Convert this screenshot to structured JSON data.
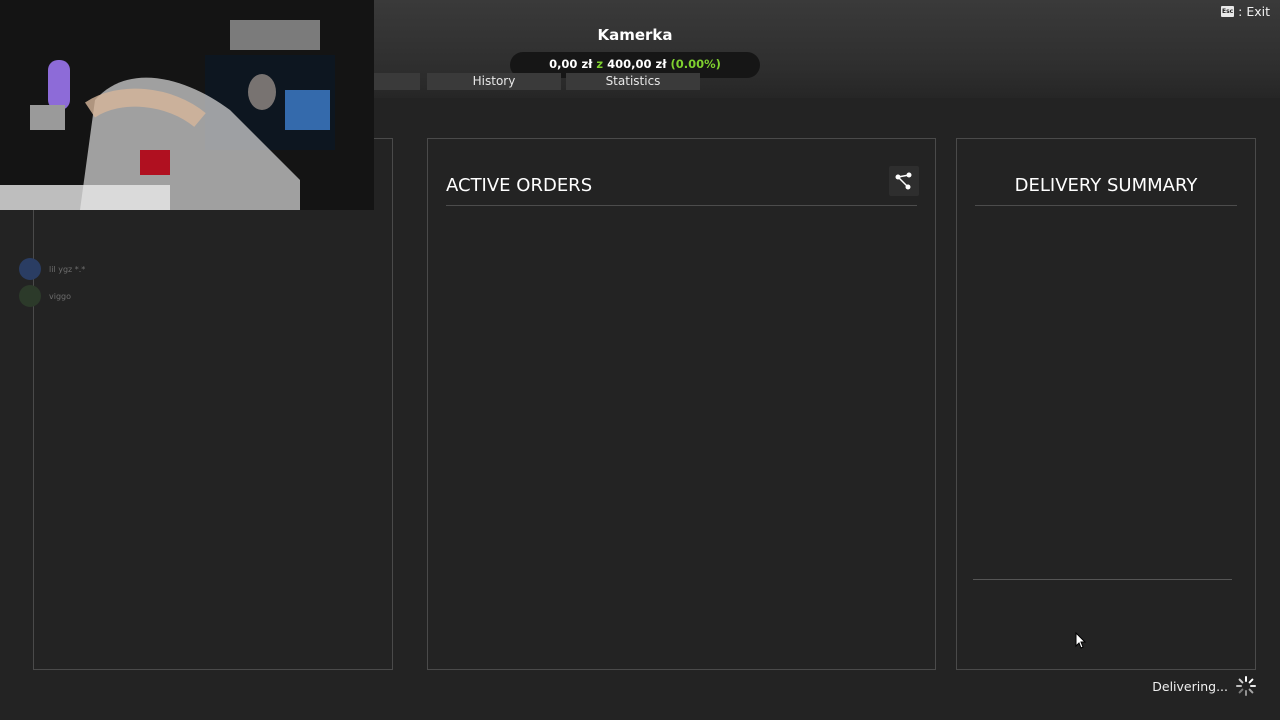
{
  "header": {
    "title": "Kamerka",
    "progress": {
      "current": "0,00 zł",
      "separator": "z",
      "goal": "400,00 zł",
      "percent": "(0.00%)"
    },
    "tabs": [
      {
        "label": "History"
      },
      {
        "label": "Statistics"
      }
    ],
    "exit": {
      "key": "Esc",
      "label": ": Exit"
    }
  },
  "panels": {
    "active_orders": {
      "title": "ACTIVE ORDERS",
      "icon": "share-icon"
    },
    "delivery_summary": {
      "title": "DELIVERY SUMMARY"
    }
  },
  "chat": [
    {
      "user": "lil ygz *.*",
      "color": "#2a3d63"
    },
    {
      "user": "viggo",
      "color": "#2c3a2a"
    }
  ],
  "status": {
    "label": "Delivering...",
    "icon": "spinner-icon"
  },
  "colors": {
    "accent_green": "#7fd12f",
    "background": "#232323"
  }
}
